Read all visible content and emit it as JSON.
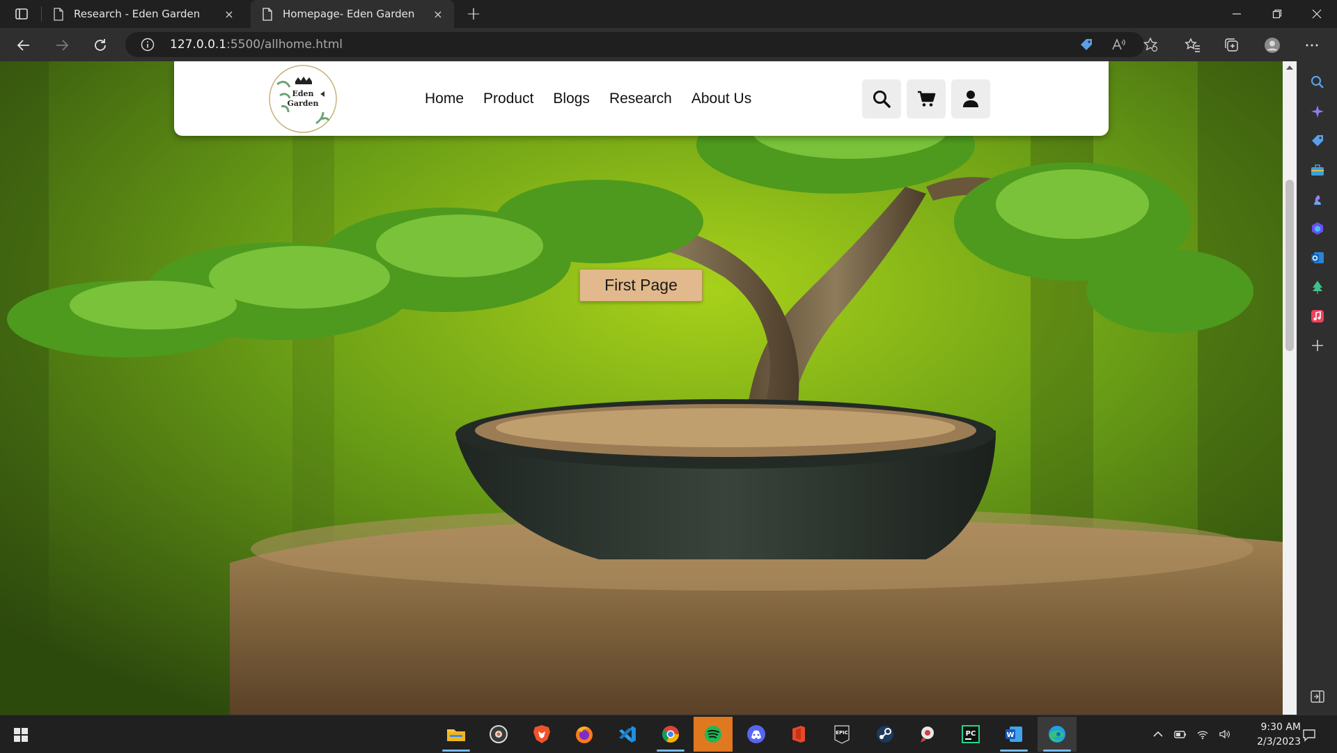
{
  "browser": {
    "tabs": [
      {
        "title": "Research - Eden Garden",
        "close": "×"
      },
      {
        "title": "Homepage- Eden Garden",
        "close": "×"
      }
    ],
    "new_tab": "+",
    "address": {
      "host": "127.0.0.1",
      "path": ":5500/allhome.html"
    }
  },
  "site": {
    "logo_text_line1": "Eden",
    "logo_text_line2": "Garden",
    "menu": [
      "Home",
      "Product",
      "Blogs",
      "Research",
      "About Us"
    ],
    "cta_label": "First Page",
    "accent_color": "#e2b98c"
  },
  "icons": {
    "nav": [
      "search-icon",
      "cart-icon",
      "user-icon"
    ]
  },
  "taskbar": {
    "time": "9:30 AM",
    "date": "2/3/2023"
  }
}
